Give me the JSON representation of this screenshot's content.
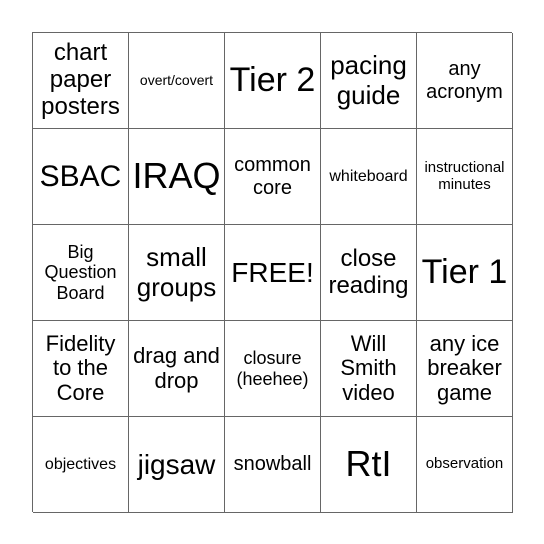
{
  "bingo": {
    "cells": [
      [
        "chart paper posters",
        "overt/covert",
        "Tier 2",
        "pacing guide",
        "any acronym"
      ],
      [
        "SBAC",
        "IRAQ",
        "common core",
        "whiteboard",
        "instructional minutes"
      ],
      [
        "Big Question Board",
        "small groups",
        "FREE!",
        "close reading",
        "Tier 1"
      ],
      [
        "Fidelity to the Core",
        "drag and drop",
        "closure (heehee)",
        "Will Smith video",
        "any ice breaker game"
      ],
      [
        "objectives",
        "jigsaw",
        "snowball",
        "RtI",
        "observation"
      ]
    ]
  }
}
